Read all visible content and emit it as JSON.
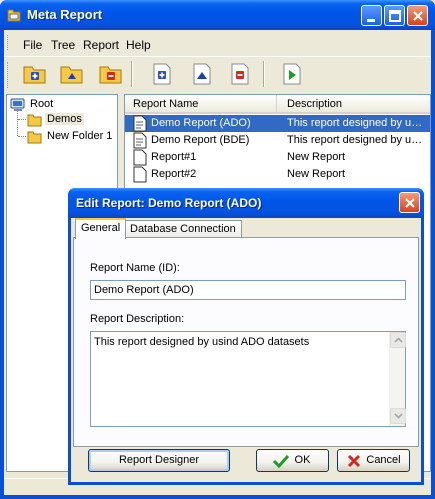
{
  "window": {
    "title": "Meta Report"
  },
  "menu": [
    "File",
    "Tree",
    "Report",
    "Help"
  ],
  "toolbar_icons": [
    "add-folder-icon",
    "edit-folder-icon",
    "delete-folder-icon",
    "add-report-icon",
    "edit-report-icon",
    "delete-report-icon",
    "run-report-icon"
  ],
  "tree": {
    "root": "Root",
    "children": [
      "Demos",
      "New Folder 1"
    ]
  },
  "list": {
    "columns": [
      "Report Name",
      "Description"
    ],
    "rows": [
      {
        "name": "Demo Report (ADO)",
        "description": "This report designed by usind ADO datasets"
      },
      {
        "name": "Demo Report (BDE)",
        "description": "This report designed by usind BDE datasets"
      },
      {
        "name": "Report#1",
        "description": "New Report"
      },
      {
        "name": "Report#2",
        "description": "New Report"
      }
    ]
  },
  "dialog": {
    "title": "Edit Report: Demo Report (ADO)",
    "tabs": [
      "General",
      "Database Connection"
    ],
    "report_name_label": "Report Name (ID):",
    "report_name_value": "Demo Report (ADO)",
    "description_label": "Report Description:",
    "description_value": "This report designed by usind ADO datasets",
    "designer_button": "Report Designer",
    "ok_button": "OK",
    "cancel_button": "Cancel"
  },
  "colors": {
    "titlebar": "#0055e6",
    "selection": "#316ac5",
    "face": "#ece9d8"
  }
}
